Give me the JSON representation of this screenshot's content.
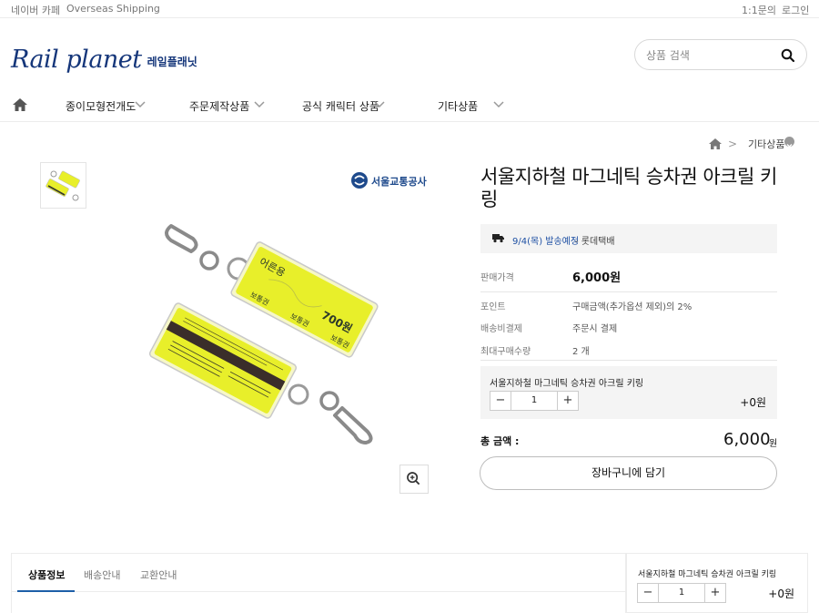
{
  "topbar": {
    "cafe_link": "네이버 카페",
    "overseas_link": "Overseas Shipping",
    "inquiry_link": "1:1문의",
    "login_link": "로그인"
  },
  "header": {
    "logo_text": "Rail planet",
    "logo_sub": "레일플래닛",
    "search_placeholder": "상품 검색"
  },
  "nav": {
    "items": [
      {
        "label": "종이모형전개도"
      },
      {
        "label": "주문제작상품"
      },
      {
        "label": "공식 캐릭터 상품"
      },
      {
        "label": "기타상품"
      }
    ]
  },
  "breadcrumb": {
    "separator": ">",
    "category": "기타상품"
  },
  "image": {
    "brand_text": "서울교통공사",
    "tag_top_text": "어른용",
    "tag_price_text": "700원",
    "tag_repeat_text": "보통권",
    "stripe_color": "#e8ef2a"
  },
  "product": {
    "title": "서울지하철 마그네틱 승차권 아크릴 키링",
    "shipping_date": "9/4(목) 발송예정",
    "shipping_carrier": "- 롯데택배",
    "rows": [
      {
        "label": "판매가격",
        "value": "6,000원"
      },
      {
        "label": "포인트",
        "value": "구매금액(추가옵션 제외)의 2%"
      },
      {
        "label": "배송비결제",
        "value": "주문시 결제"
      },
      {
        "label": "최대구매수량",
        "value": "2 개"
      }
    ],
    "option_name": "서울지하철 마그네틱 승차권 아크릴 키링",
    "quantity": "1",
    "minus": "−",
    "plus": "+",
    "option_price": "+0원",
    "total_label": "총 금액 :",
    "total_value": "6,000",
    "total_unit": "원",
    "cart_button": "장바구니에 담기"
  },
  "tabs": [
    {
      "label": "상품정보"
    },
    {
      "label": "배송안내"
    },
    {
      "label": "교환안내"
    }
  ],
  "sidebox": {
    "name": "서울지하철 마그네틱 승차권 아크릴 키링",
    "quantity": "1",
    "price": "+0원"
  },
  "colors": {
    "brand": "#15367a",
    "accent_blue": "#1d4fa3",
    "tab_underline": "#1d5fa8"
  }
}
